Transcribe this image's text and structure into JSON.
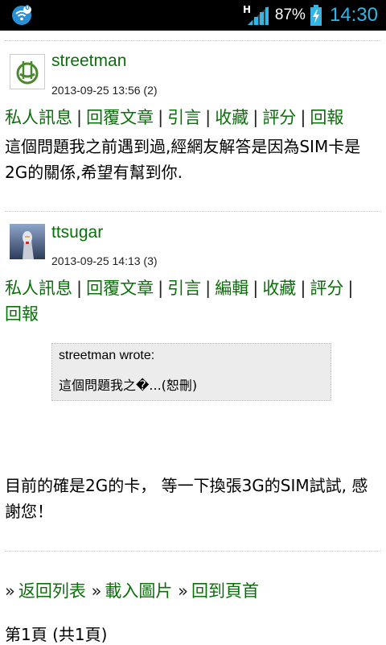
{
  "status_bar": {
    "network_type": "H",
    "battery_percent": "87%",
    "time": "14:30",
    "wifi_badge": "0",
    "icons": [
      "wifi-icon",
      "signal-icon",
      "battery-charging-icon"
    ]
  },
  "posts": [
    {
      "username": "streetman",
      "timestamp": "2013-09-25 13:56 (2)",
      "avatar_icon": "chopsticks-avatar-icon",
      "actions": [
        "私人訊息",
        "回覆文章",
        "引言",
        "收藏",
        "評分",
        "回報"
      ],
      "body": "這個問題我之前遇到過,經網友解答是因為SIM卡是2G的關係,希望有幫到你."
    },
    {
      "username": "ttsugar",
      "timestamp": "2013-09-25 14:13 (3)",
      "avatar_icon": "robot-avatar-icon",
      "actions": [
        "私人訊息",
        "回覆文章",
        "引言",
        "編輯",
        "收藏",
        "評分",
        "回報"
      ],
      "quote": {
        "author_line": "streetman wrote:",
        "text": "這個問題我之�...(恕刪)"
      },
      "body": "目前的確是2G的卡， 等一下換張3G的SIM試試, 感謝您！"
    }
  ],
  "footer": {
    "links": [
      "返回列表",
      "載入圖片",
      "回到頁首"
    ],
    "arrow_glyph": "»",
    "page_info": "第1頁 (共1頁)"
  },
  "colors": {
    "link_green": "#0b6e0b",
    "clock_blue": "#33b5e5",
    "quote_bg": "#ececec"
  }
}
